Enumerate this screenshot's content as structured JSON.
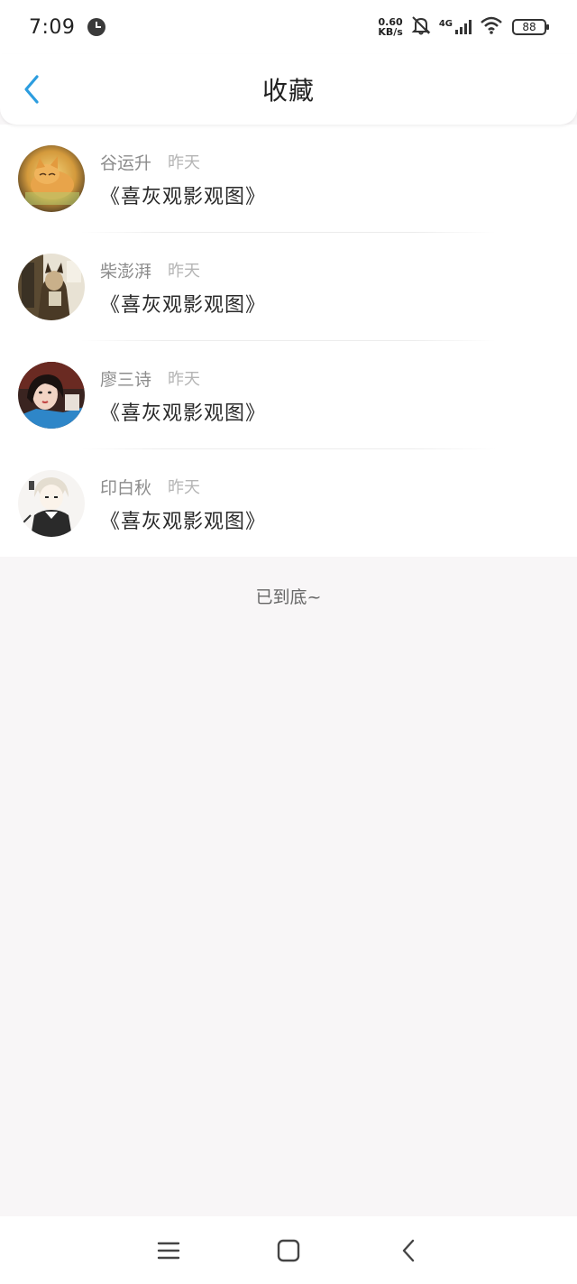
{
  "status_bar": {
    "time": "7:09",
    "net_speed_value": "0.60",
    "net_speed_unit": "KB/s",
    "network": "4G",
    "battery": "88"
  },
  "header": {
    "title": "收藏",
    "accent_color": "#2c9ddf"
  },
  "favorites": [
    {
      "name": "谷运升",
      "time": "昨天",
      "title": "《喜灰观影观图》",
      "avatar": "cat-avatar"
    },
    {
      "name": "柴澎湃",
      "time": "昨天",
      "title": "《喜灰观影观图》",
      "avatar": "cat-figure-avatar"
    },
    {
      "name": "廖三诗",
      "time": "昨天",
      "title": "《喜灰观影观图》",
      "avatar": "woman-avatar"
    },
    {
      "name": "印白秋",
      "time": "昨天",
      "title": "《喜灰观影观图》",
      "avatar": "anime-avatar"
    }
  ],
  "footer": {
    "end_text": "已到底~"
  }
}
